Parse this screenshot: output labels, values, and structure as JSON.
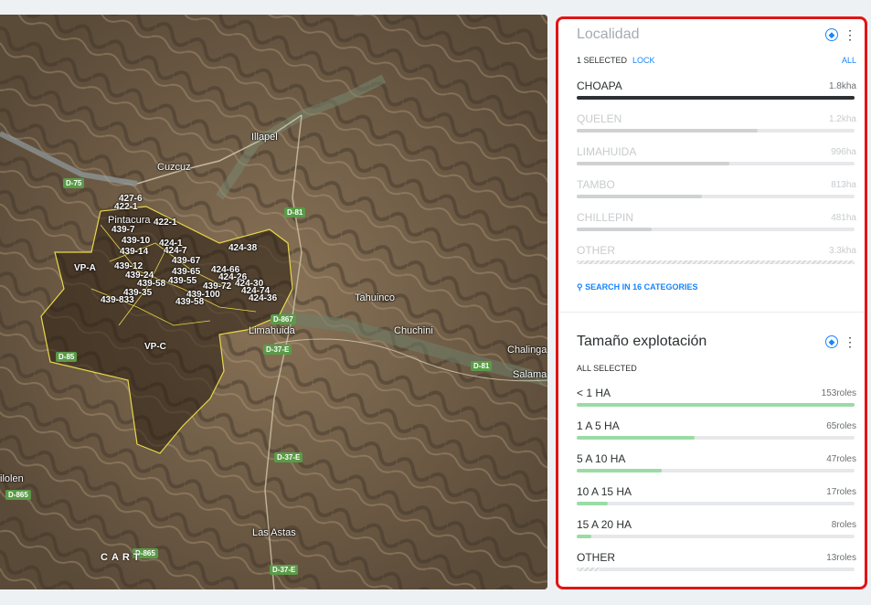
{
  "map": {
    "places": [
      "Illapel",
      "Cuzcuz",
      "Pintacura",
      "Tahuinco",
      "Chuchini",
      "Limahuida",
      "Chalinga",
      "Salama",
      "Las Astas",
      "ilolen"
    ],
    "roads": [
      "D-75",
      "D-81",
      "D-867",
      "D-37-E",
      "D-85",
      "D-81",
      "D-37-E",
      "D-865",
      "D-865",
      "D-37-E"
    ],
    "polygons": [
      "427-6",
      "422-1",
      "439-7",
      "422-1",
      "439-10",
      "424-1",
      "439-14",
      "424-7",
      "424-38",
      "439-67",
      "VP-A",
      "439-12",
      "439-65",
      "424-66",
      "439-24",
      "424-26",
      "439-55",
      "439-58",
      "439-72",
      "424-30",
      "439-35",
      "439-100",
      "424-74",
      "439-833",
      "439-58",
      "424-36",
      "VP-C"
    ],
    "attribution": "CART"
  },
  "localidad": {
    "title": "Localidad",
    "selected_text": "1 SELECTED",
    "lock_label": "LOCK",
    "all_label": "ALL",
    "drop_icon": "water-drop-icon",
    "menu_icon": "more-vertical-icon",
    "categories": [
      {
        "name": "CHOAPA",
        "value": "1.8kha",
        "fraction": 1.0,
        "selected": true
      },
      {
        "name": "QUELEN",
        "value": "1.2kha",
        "fraction": 0.65,
        "selected": false
      },
      {
        "name": "LIMAHUIDA",
        "value": "996ha",
        "fraction": 0.55,
        "selected": false
      },
      {
        "name": "TAMBO",
        "value": "813ha",
        "fraction": 0.45,
        "selected": false
      },
      {
        "name": "CHILLEPIN",
        "value": "481ha",
        "fraction": 0.27,
        "selected": false
      },
      {
        "name": "OTHER",
        "value": "3.3kha",
        "fraction": 1.0,
        "selected": false
      }
    ],
    "search_label": "SEARCH IN 16 CATEGORIES",
    "colors": {
      "selected": "#2c3032",
      "unselected": "#cfd1d3",
      "other": "#d8dadc"
    }
  },
  "tamano": {
    "title": "Tamaño explotación",
    "selected_text": "ALL SELECTED",
    "drop_icon": "water-drop-icon",
    "menu_icon": "more-vertical-icon",
    "categories": [
      {
        "name": "< 1 HA",
        "value": "153roles",
        "fraction": 1.0
      },
      {
        "name": "1 A 5 HA",
        "value": "65roles",
        "fraction": 0.425
      },
      {
        "name": "5 A 10 HA",
        "value": "47roles",
        "fraction": 0.307
      },
      {
        "name": "10 A 15 HA",
        "value": "17roles",
        "fraction": 0.111
      },
      {
        "name": "15 A 20 HA",
        "value": "8roles",
        "fraction": 0.052
      },
      {
        "name": "OTHER",
        "value": "13roles",
        "fraction": 0.085
      }
    ],
    "colors": {
      "bar": "#9adba6"
    }
  }
}
